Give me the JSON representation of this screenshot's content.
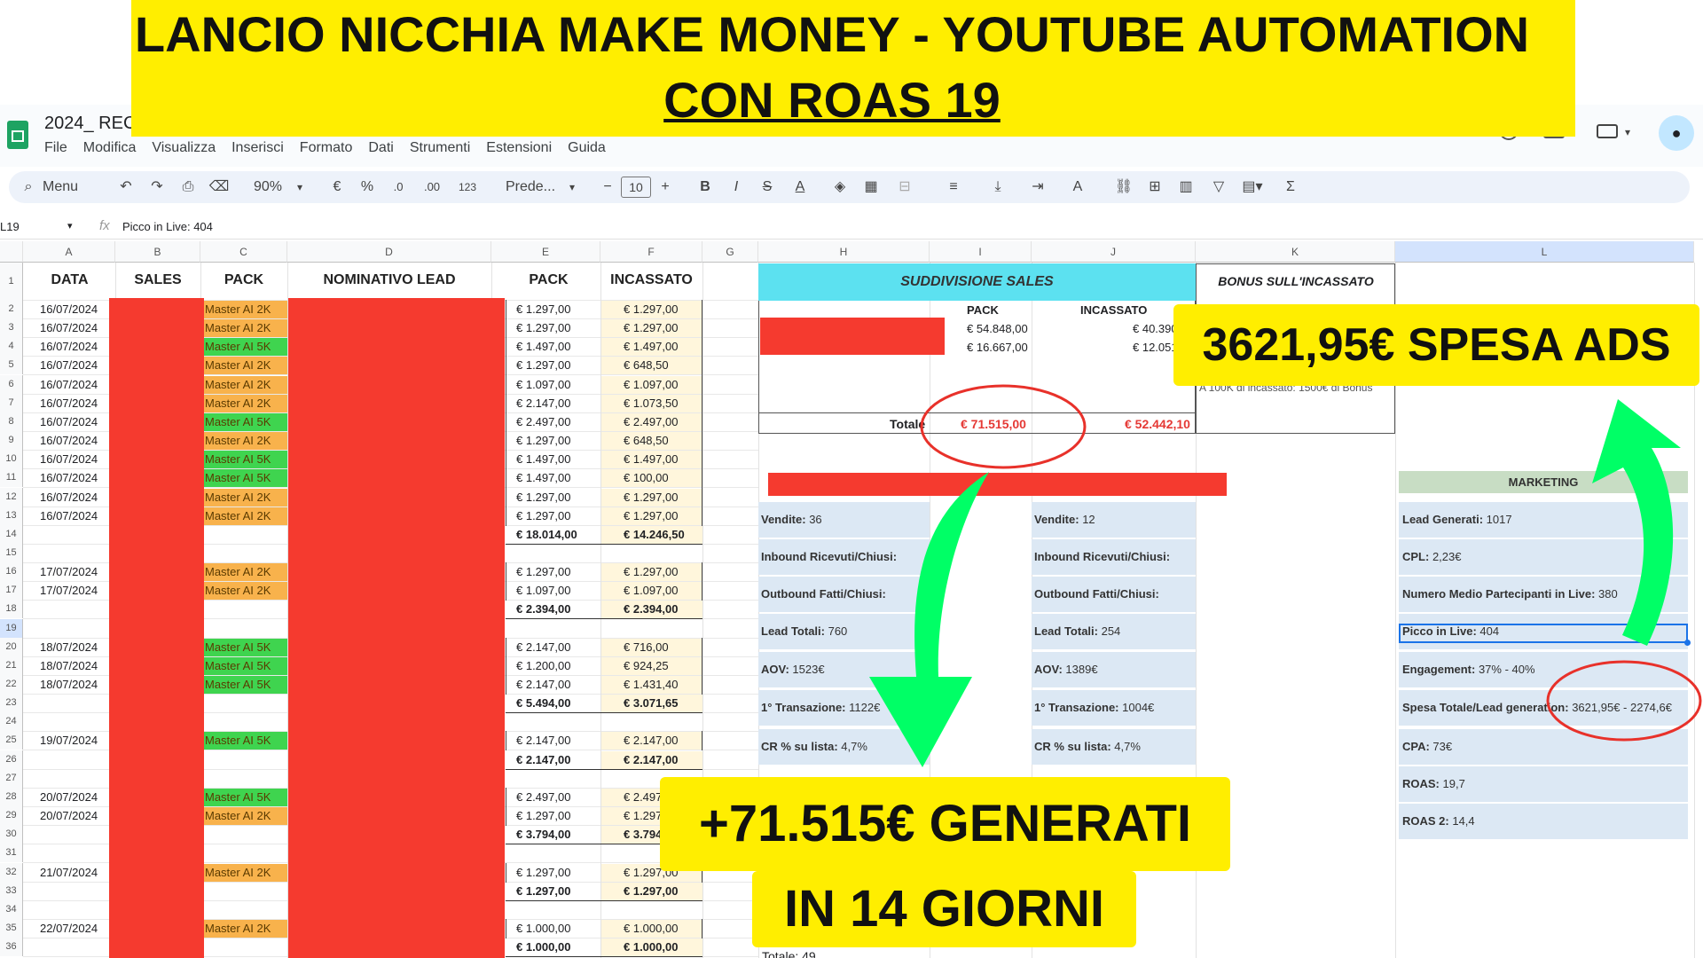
{
  "banner": {
    "line1": "LANCIO NICCHIA MAKE MONEY - YOUTUBE AUTOMATION",
    "line2": "CON ROAS 19"
  },
  "doc": {
    "title": "2024_ REC",
    "menu": [
      "File",
      "Modifica",
      "Visualizza",
      "Inserisci",
      "Formato",
      "Dati",
      "Strumenti",
      "Estensioni",
      "Guida"
    ]
  },
  "toolbar": {
    "search": "Menu",
    "zoom": "90%",
    "currency": "€",
    "percent": "%",
    "dec_less": ".0",
    "dec_more": ".00",
    "fmt123": "123",
    "font": "Prede...",
    "size": "10"
  },
  "formula": {
    "cellref": "L19",
    "fx": "fx",
    "value": "Picco in Live: 404"
  },
  "columns": [
    "A",
    "B",
    "C",
    "D",
    "E",
    "F",
    "G",
    "H",
    "I",
    "J",
    "K",
    "L"
  ],
  "headers": {
    "data": "DATA",
    "sales": "SALES",
    "pack": "PACK",
    "lead": "NOMINATIVO LEAD",
    "pack2": "PACK",
    "incassato": "INCASSATO"
  },
  "rownums": [
    "1",
    "2",
    "3",
    "4",
    "5",
    "6",
    "7",
    "8",
    "9",
    "10",
    "11",
    "12",
    "13",
    "14",
    "15",
    "16",
    "17",
    "18",
    "19",
    "20",
    "21",
    "22",
    "23",
    "24",
    "25",
    "26",
    "27",
    "28",
    "29",
    "30",
    "31",
    "32",
    "33",
    "34",
    "35",
    "36"
  ],
  "rows": [
    {
      "r": 2,
      "date": "16/07/2024",
      "pack": "Master AI 2K",
      "p": "€ 1.297,00",
      "i": "€ 1.297,00"
    },
    {
      "r": 3,
      "date": "16/07/2024",
      "pack": "Master AI 2K",
      "p": "€ 1.297,00",
      "i": "€ 1.297,00"
    },
    {
      "r": 4,
      "date": "16/07/2024",
      "pack": "Master AI 5K",
      "p": "€ 1.497,00",
      "i": "€ 1.497,00"
    },
    {
      "r": 5,
      "date": "16/07/2024",
      "pack": "Master AI 2K",
      "p": "€ 1.297,00",
      "i": "€ 648,50"
    },
    {
      "r": 6,
      "date": "16/07/2024",
      "pack": "Master AI 2K",
      "p": "€ 1.097,00",
      "i": "€ 1.097,00"
    },
    {
      "r": 7,
      "date": "16/07/2024",
      "pack": "Master AI 2K",
      "p": "€ 2.147,00",
      "i": "€ 1.073,50"
    },
    {
      "r": 8,
      "date": "16/07/2024",
      "pack": "Master AI 5K",
      "p": "€ 2.497,00",
      "i": "€ 2.497,00"
    },
    {
      "r": 9,
      "date": "16/07/2024",
      "pack": "Master AI 2K",
      "p": "€ 1.297,00",
      "i": "€ 648,50"
    },
    {
      "r": 10,
      "date": "16/07/2024",
      "pack": "Master AI 5K",
      "p": "€ 1.497,00",
      "i": "€ 1.497,00"
    },
    {
      "r": 11,
      "date": "16/07/2024",
      "pack": "Master AI 5K",
      "p": "€ 1.497,00",
      "i": "€ 100,00"
    },
    {
      "r": 12,
      "date": "16/07/2024",
      "pack": "Master AI 2K",
      "p": "€ 1.297,00",
      "i": "€ 1.297,00"
    },
    {
      "r": 13,
      "date": "16/07/2024",
      "pack": "Master AI 2K",
      "p": "€ 1.297,00",
      "i": "€ 1.297,00"
    },
    {
      "r": 14,
      "date": "",
      "pack": "",
      "p": "€ 18.014,00",
      "i": "€ 14.246,50",
      "total": true
    },
    {
      "r": 16,
      "date": "17/07/2024",
      "pack": "Master AI 2K",
      "p": "€ 1.297,00",
      "i": "€ 1.297,00"
    },
    {
      "r": 17,
      "date": "17/07/2024",
      "pack": "Master AI 2K",
      "p": "€ 1.097,00",
      "i": "€ 1.097,00"
    },
    {
      "r": 18,
      "date": "",
      "pack": "",
      "p": "€ 2.394,00",
      "i": "€ 2.394,00",
      "total": true
    },
    {
      "r": 20,
      "date": "18/07/2024",
      "pack": "Master AI 5K",
      "p": "€ 2.147,00",
      "i": "€ 716,00"
    },
    {
      "r": 21,
      "date": "18/07/2024",
      "pack": "Master AI 5K",
      "p": "€ 1.200,00",
      "i": "€ 924,25"
    },
    {
      "r": 22,
      "date": "18/07/2024",
      "pack": "Master AI 5K",
      "p": "€ 2.147,00",
      "i": "€ 1.431,40"
    },
    {
      "r": 23,
      "date": "",
      "pack": "",
      "p": "€ 5.494,00",
      "i": "€ 3.071,65",
      "total": true
    },
    {
      "r": 25,
      "date": "19/07/2024",
      "pack": "Master AI 5K",
      "p": "€ 2.147,00",
      "i": "€ 2.147,00"
    },
    {
      "r": 26,
      "date": "",
      "pack": "",
      "p": "€ 2.147,00",
      "i": "€ 2.147,00",
      "total": true
    },
    {
      "r": 28,
      "date": "20/07/2024",
      "pack": "Master AI 5K",
      "p": "€ 2.497,00",
      "i": "€ 2.497,00"
    },
    {
      "r": 29,
      "date": "20/07/2024",
      "pack": "Master AI 2K",
      "p": "€ 1.297,00",
      "i": "€ 1.297,00"
    },
    {
      "r": 30,
      "date": "",
      "pack": "",
      "p": "€ 3.794,00",
      "i": "€ 3.794,00",
      "total": true
    },
    {
      "r": 32,
      "date": "21/07/2024",
      "pack": "Master AI 2K",
      "p": "€ 1.297,00",
      "i": "€ 1.297,00"
    },
    {
      "r": 33,
      "date": "",
      "pack": "",
      "p": "€ 1.297,00",
      "i": "€ 1.297,00",
      "total": true
    },
    {
      "r": 35,
      "date": "22/07/2024",
      "pack": "Master AI 2K",
      "p": "€ 1.000,00",
      "i": "€ 1.000,00"
    },
    {
      "r": 36,
      "date": "",
      "pack": "",
      "p": "€ 1.000,00",
      "i": "€ 1.000,00",
      "total": true
    }
  ],
  "sales_split": {
    "title": "SUDDIVISIONE SALES",
    "col_pack": "PACK",
    "col_inc": "INCASSATO",
    "rows": [
      {
        "pack": "€ 54.848,00",
        "inc": "€ 40.390"
      },
      {
        "pack": "€ 16.667,00",
        "inc": "€ 12.051"
      }
    ],
    "total_label": "Totale",
    "total_pack": "€ 71.515,00",
    "total_inc": "€ 52.442,10"
  },
  "bonus": {
    "title": "BONUS SULL'INCASSATO",
    "note": "A 100K di incassato: 1500€ di Bonus"
  },
  "stats_left": [
    {
      "k": "Vendite:",
      "v": " 36"
    },
    {
      "k": "Inbound Ricevuti/Chiusi:",
      "v": ""
    },
    {
      "k": "Outbound Fatti/Chiusi:",
      "v": ""
    },
    {
      "k": "Lead Totali:",
      "v": " 760"
    },
    {
      "k": "AOV:",
      "v": " 1523€"
    },
    {
      "k": "1° Transazione:",
      "v": " 1122€"
    },
    {
      "k": "CR % su lista:",
      "v": " 4,7%"
    }
  ],
  "stats_right": [
    {
      "k": "Vendite:",
      "v": " 12"
    },
    {
      "k": "Inbound Ricevuti/Chiusi:",
      "v": ""
    },
    {
      "k": "Outbound Fatti/Chiusi:",
      "v": ""
    },
    {
      "k": "Lead Totali:",
      "v": " 254"
    },
    {
      "k": "AOV:",
      "v": " 1389€"
    },
    {
      "k": "1° Transazione:",
      "v": " 1004€"
    },
    {
      "k": "CR % su lista:",
      "v": " 4,7%"
    }
  ],
  "total_bottom": "Totale: 49",
  "marketing": {
    "title": "MARKETING",
    "items": [
      {
        "k": "Lead Generati:",
        "v": " 1017"
      },
      {
        "k": "CPL:",
        "v": " 2,23€"
      },
      {
        "k": "Numero Medio Partecipanti in Live:",
        "v": " 380"
      },
      {
        "k": "Picco in Live:",
        "v": " 404"
      },
      {
        "k": "Engagement:",
        "v": " 37% - 40%"
      },
      {
        "k": "Spesa Totale/Lead generation:",
        "v": " 3621,95€ - 2274,6€"
      },
      {
        "k": "CPA:",
        "v": " 73€"
      },
      {
        "k": "ROAS:",
        "v": " 19,7"
      },
      {
        "k": "ROAS 2:",
        "v": " 14,4"
      }
    ]
  },
  "callout_ads": "3621,95€ SPESA ADS",
  "callout_gen1": "+71.515€ GENERATI",
  "callout_gen2": "IN 14 GIORNI",
  "stray_pct": "%",
  "colors": {
    "yellow": "#ffee00",
    "red": "#f53a2f",
    "green": "#00ff66",
    "cyan": "#5ce1f0"
  }
}
